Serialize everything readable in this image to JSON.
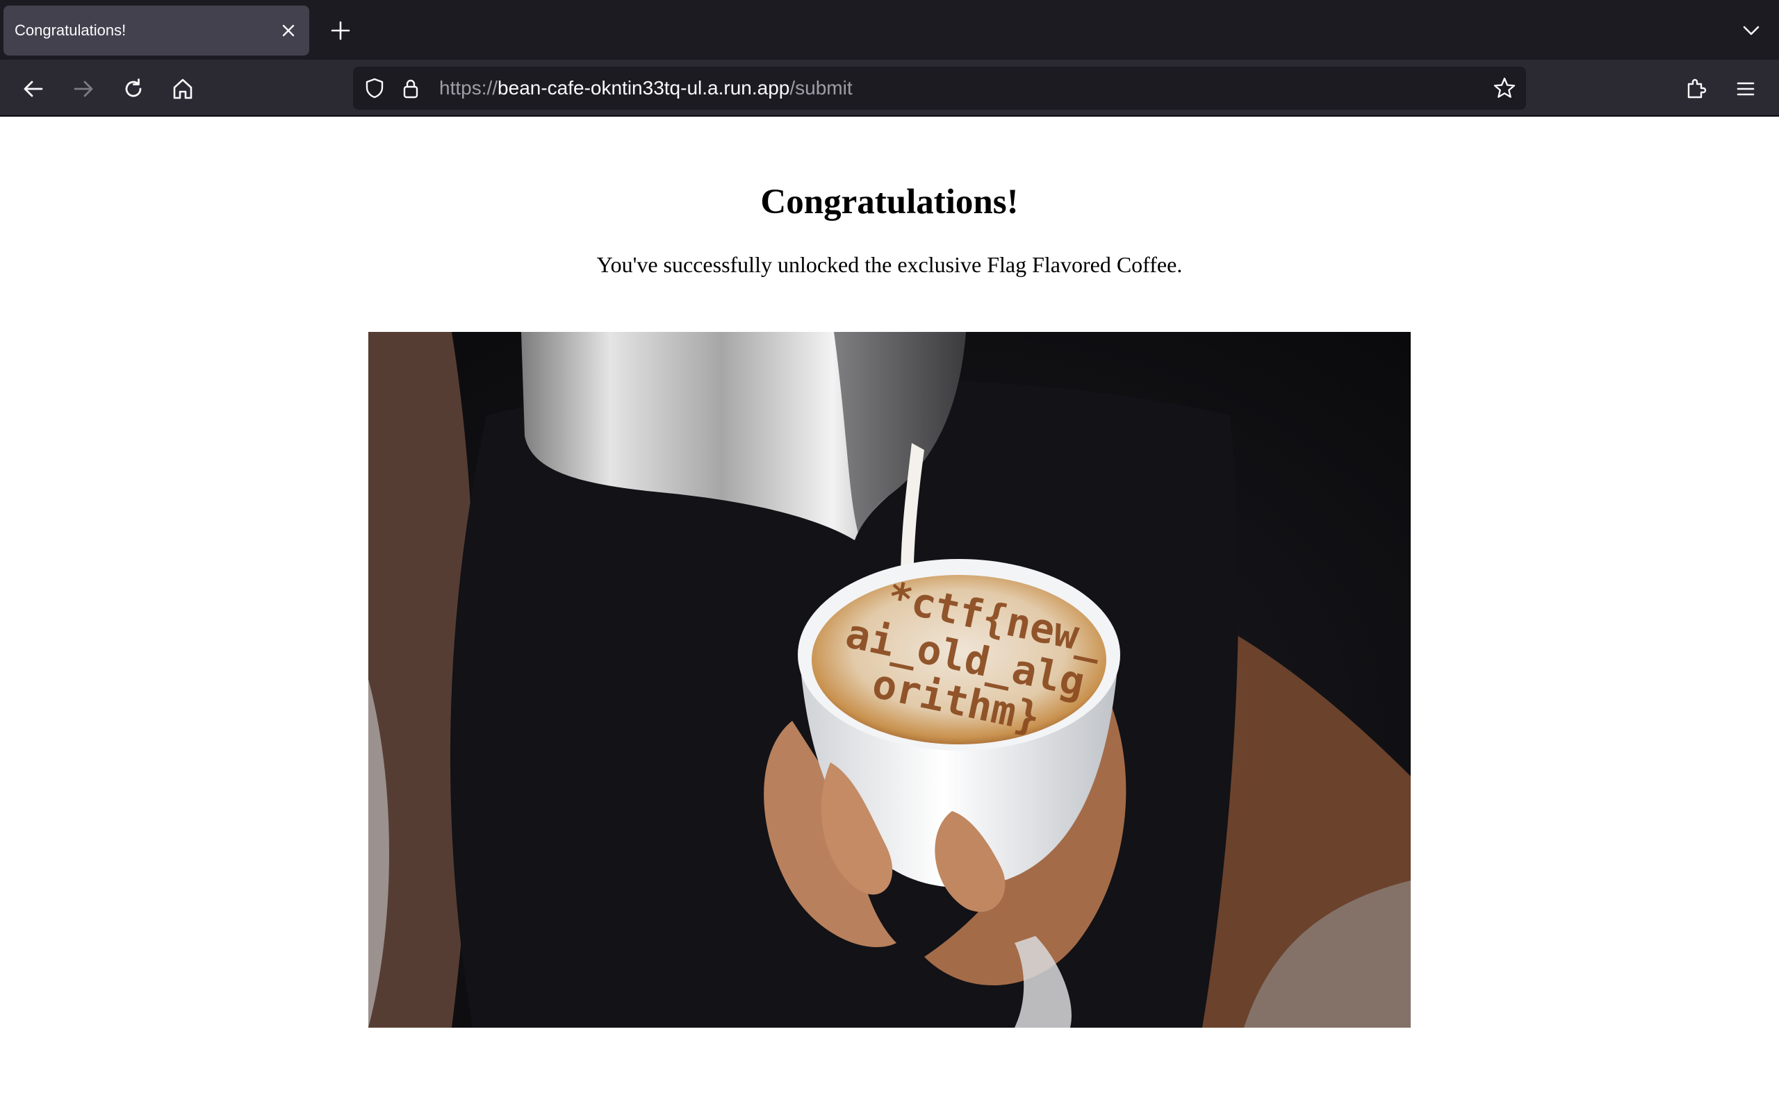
{
  "browser": {
    "tab": {
      "title": "Congratulations!"
    },
    "url": {
      "scheme": "https://",
      "host": "bean-cafe-okntin33tq-ul.a.run.app",
      "path": "/submit"
    },
    "icons": {
      "tab_close": "close-icon",
      "new_tab": "plus-icon",
      "list_tabs": "chevron-down-icon",
      "back": "arrow-left-icon",
      "forward": "arrow-right-icon",
      "reload": "reload-icon",
      "home": "home-icon",
      "tracking_protection": "shield-icon",
      "site_security": "lock-icon",
      "bookmark": "star-icon",
      "extensions": "puzzle-icon",
      "menu": "hamburger-icon"
    },
    "colors": {
      "tabbar_bg": "#1c1b22",
      "active_tab_bg": "#42414d",
      "toolbar_bg": "#2b2a33",
      "urlbar_bg": "#1c1b22"
    }
  },
  "page": {
    "heading": "Congratulations!",
    "message": "You've successfully unlocked the exclusive Flag Flavored Coffee.",
    "image": {
      "latte_art_lines": [
        "*ctf{new_",
        "ai_old_alg",
        "orithm}"
      ]
    }
  }
}
